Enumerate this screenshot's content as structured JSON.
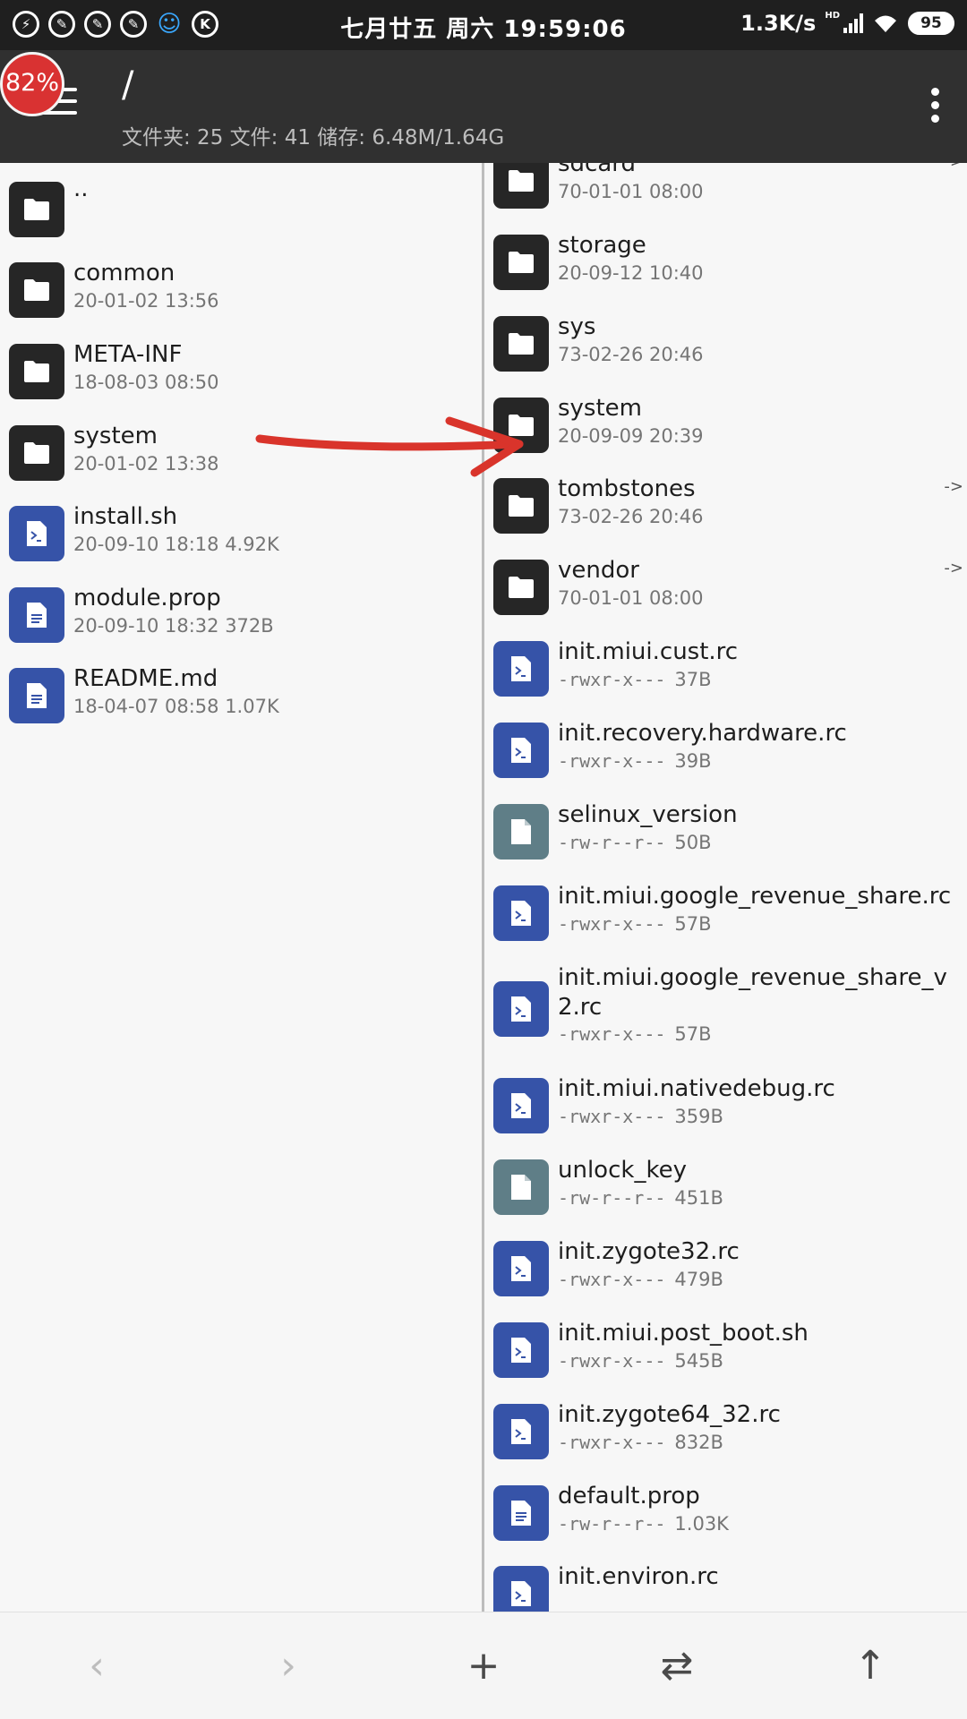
{
  "status_bar": {
    "time": "七月廿五 周六 19:59:06",
    "net_speed": "1.3K/s",
    "network_tag": "HD",
    "battery": "95",
    "left_icons": [
      "shield-icon",
      "wrench-icon",
      "wrench-icon",
      "wrench-icon",
      "qq-icon",
      "k-icon"
    ]
  },
  "toolbar": {
    "badge": "82%",
    "path": "/",
    "stats": "文件夹: 25  文件: 41  储存: 6.48M/1.64G"
  },
  "left_pane": {
    "items": [
      {
        "name": "..",
        "meta": "",
        "icon": "folder"
      },
      {
        "name": "common",
        "meta": "20-01-02 13:56",
        "icon": "folder"
      },
      {
        "name": "META-INF",
        "meta": "18-08-03 08:50",
        "icon": "folder"
      },
      {
        "name": "system",
        "meta": "20-01-02 13:38",
        "icon": "folder"
      },
      {
        "name": "install.sh",
        "meta": "20-09-10 18:18  4.92K",
        "icon": "script"
      },
      {
        "name": "module.prop",
        "meta": "20-09-10 18:32  372B",
        "icon": "doc"
      },
      {
        "name": "README.md",
        "meta": "18-04-07 08:58  1.07K",
        "icon": "doc"
      }
    ]
  },
  "right_pane": {
    "items": [
      {
        "name": "sdcard",
        "meta": "70-01-01 08:00",
        "icon": "folder",
        "link": "->"
      },
      {
        "name": "storage",
        "meta": "20-09-12 10:40",
        "icon": "folder",
        "link": ""
      },
      {
        "name": "sys",
        "meta": "73-02-26 20:46",
        "icon": "folder",
        "link": ""
      },
      {
        "name": "system",
        "meta": "20-09-09 20:39",
        "icon": "folder",
        "link": ""
      },
      {
        "name": "tombstones",
        "meta": "73-02-26 20:46",
        "icon": "folder",
        "link": "->"
      },
      {
        "name": "vendor",
        "meta": "70-01-01 08:00",
        "icon": "folder",
        "link": "->"
      },
      {
        "name": "init.miui.cust.rc",
        "perm": "-rwxr-x---",
        "size": "37B",
        "icon": "script"
      },
      {
        "name": "init.recovery.hardware.rc",
        "perm": "-rwxr-x---",
        "size": "39B",
        "icon": "script"
      },
      {
        "name": "selinux_version",
        "perm": "-rw-r--r--",
        "size": "50B",
        "icon": "file"
      },
      {
        "name": "init.miui.google_revenue_share.rc",
        "perm": "-rwxr-x---",
        "size": "57B",
        "icon": "script"
      },
      {
        "name": "init.miui.google_revenue_share_v",
        "name2": "2.rc",
        "perm": "-rwxr-x---",
        "size": "57B",
        "icon": "script"
      },
      {
        "name": "init.miui.nativedebug.rc",
        "perm": "-rwxr-x---",
        "size": "359B",
        "icon": "script"
      },
      {
        "name": "unlock_key",
        "perm": "-rw-r--r--",
        "size": "451B",
        "icon": "file"
      },
      {
        "name": "init.zygote32.rc",
        "perm": "-rwxr-x---",
        "size": "479B",
        "icon": "script"
      },
      {
        "name": "init.miui.post_boot.sh",
        "perm": "-rwxr-x---",
        "size": "545B",
        "icon": "script"
      },
      {
        "name": "init.zygote64_32.rc",
        "perm": "-rwxr-x---",
        "size": "832B",
        "icon": "script"
      },
      {
        "name": "default.prop",
        "perm": "-rw-r--r--",
        "size": "1.03K",
        "icon": "doc"
      },
      {
        "name": "init.environ.rc",
        "perm": "",
        "size": "",
        "icon": "script"
      }
    ]
  },
  "bottom_bar": {
    "buttons": [
      {
        "name": "back-button",
        "glyph": "‹",
        "enabled": false
      },
      {
        "name": "forward-button",
        "glyph": "›",
        "enabled": false
      },
      {
        "name": "add-button",
        "glyph": "+",
        "enabled": true
      },
      {
        "name": "swap-panes-button",
        "glyph": "⇄",
        "enabled": true
      },
      {
        "name": "parent-dir-button",
        "glyph": "↑",
        "enabled": true
      }
    ]
  },
  "colors": {
    "folder_icon_bg": "#262626",
    "script_icon_bg": "#3653a8",
    "file_icon_bg": "#5f7e87",
    "annotation_arrow": "#d9342b",
    "badge": "#d93232"
  }
}
